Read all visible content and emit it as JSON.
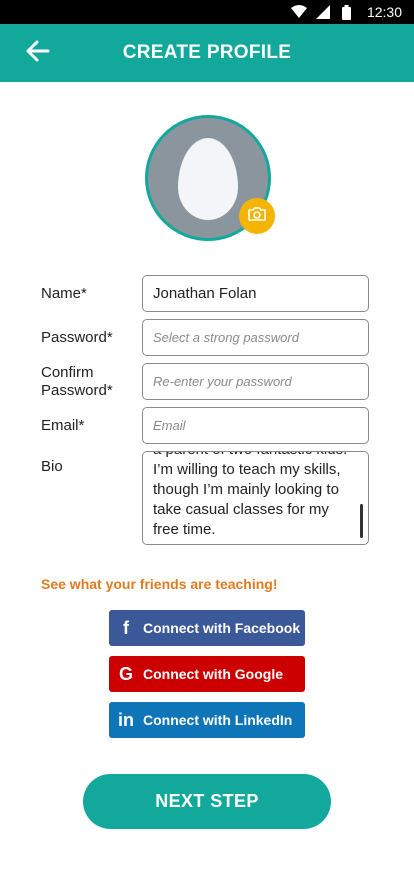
{
  "status_bar": {
    "time": "12:30",
    "icons": [
      "wifi-icon",
      "signal-icon",
      "battery-icon"
    ]
  },
  "app_bar": {
    "title": "CREATE PROFILE",
    "back_icon": "arrow-left-icon"
  },
  "avatar": {
    "icon": "egg-placeholder",
    "camera_icon": "camera-icon"
  },
  "form": {
    "name": {
      "label": "Name*",
      "value": "Jonathan Folan"
    },
    "password": {
      "label": "Password*",
      "placeholder": "Select a strong password"
    },
    "confirm": {
      "label_line1": "Confirm",
      "label_line2": "Password*",
      "placeholder": "Re-enter your password"
    },
    "email": {
      "label": "Email*",
      "placeholder": "Email"
    },
    "bio": {
      "label": "Bio",
      "value": "a parent of two fantastic kids. I’m willing to teach my skills, though I’m mainly looking to take casual classes for my free time."
    }
  },
  "friends": {
    "heading": "See what your friends are teaching!",
    "facebook": {
      "label": "Connect with Facebook",
      "icon": "f"
    },
    "google": {
      "label": "Connect with Google",
      "icon": "G"
    },
    "linkedin": {
      "label": "Connect with LinkedIn",
      "icon": "in"
    }
  },
  "next_button": "NEXT STEP",
  "colors": {
    "primary": "#12a99c",
    "accent": "#f4b400",
    "heading": "#e07b1f",
    "facebook": "#3b5998",
    "google": "#cc0000",
    "linkedin": "#0e76b8"
  }
}
